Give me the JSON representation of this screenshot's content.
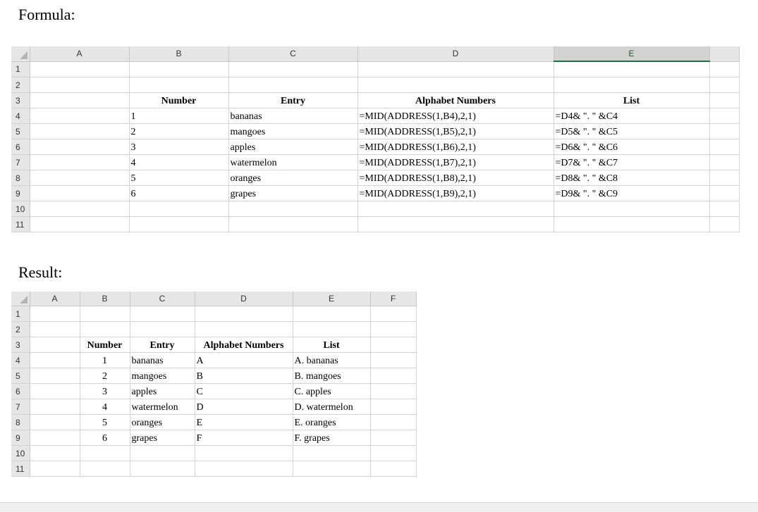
{
  "formula_label": "Formula:",
  "result_label": "Result:",
  "formula_sheet": {
    "columns": [
      "A",
      "B",
      "C",
      "D",
      "E"
    ],
    "selected_column": "E",
    "rows": [
      "1",
      "2",
      "3",
      "4",
      "5",
      "6",
      "7",
      "8",
      "9",
      "10",
      "11"
    ],
    "headers": {
      "number": "Number",
      "entry": "Entry",
      "alphabet": "Alphabet Numbers",
      "list": "List"
    },
    "data": [
      {
        "number": "1",
        "entry": "bananas",
        "alphabet": "=MID(ADDRESS(1,B4),2,1)",
        "list": "=D4& \". \"  &C4"
      },
      {
        "number": "2",
        "entry": "mangoes",
        "alphabet": "=MID(ADDRESS(1,B5),2,1)",
        "list": "=D5& \". \"  &C5"
      },
      {
        "number": "3",
        "entry": "apples",
        "alphabet": "=MID(ADDRESS(1,B6),2,1)",
        "list": "=D6& \". \"  &C6"
      },
      {
        "number": "4",
        "entry": "watermelon",
        "alphabet": "=MID(ADDRESS(1,B7),2,1)",
        "list": "=D7& \". \"  &C7"
      },
      {
        "number": "5",
        "entry": "oranges",
        "alphabet": "=MID(ADDRESS(1,B8),2,1)",
        "list": "=D8& \". \"  &C8"
      },
      {
        "number": "6",
        "entry": "grapes",
        "alphabet": "=MID(ADDRESS(1,B9),2,1)",
        "list": "=D9& \". \"  &C9"
      }
    ]
  },
  "result_sheet": {
    "columns": [
      "A",
      "B",
      "C",
      "D",
      "E",
      "F"
    ],
    "rows": [
      "1",
      "2",
      "3",
      "4",
      "5",
      "6",
      "7",
      "8",
      "9",
      "10",
      "11"
    ],
    "headers": {
      "number": "Number",
      "entry": "Entry",
      "alphabet": "Alphabet Numbers",
      "list": "List"
    },
    "data": [
      {
        "number": "1",
        "entry": "bananas",
        "alphabet": "A",
        "list": "A. bananas"
      },
      {
        "number": "2",
        "entry": "mangoes",
        "alphabet": "B",
        "list": "B. mangoes"
      },
      {
        "number": "3",
        "entry": "apples",
        "alphabet": "C",
        "list": "C. apples"
      },
      {
        "number": "4",
        "entry": "watermelon",
        "alphabet": "D",
        "list": "D. watermelon"
      },
      {
        "number": "5",
        "entry": "oranges",
        "alphabet": "E",
        "list": "E. oranges"
      },
      {
        "number": "6",
        "entry": "grapes",
        "alphabet": "F",
        "list": "F. grapes"
      }
    ]
  },
  "colors": {
    "header_bg": "#e6e6e6",
    "selected_accent": "#217346",
    "gridline": "#d4d4d4"
  }
}
